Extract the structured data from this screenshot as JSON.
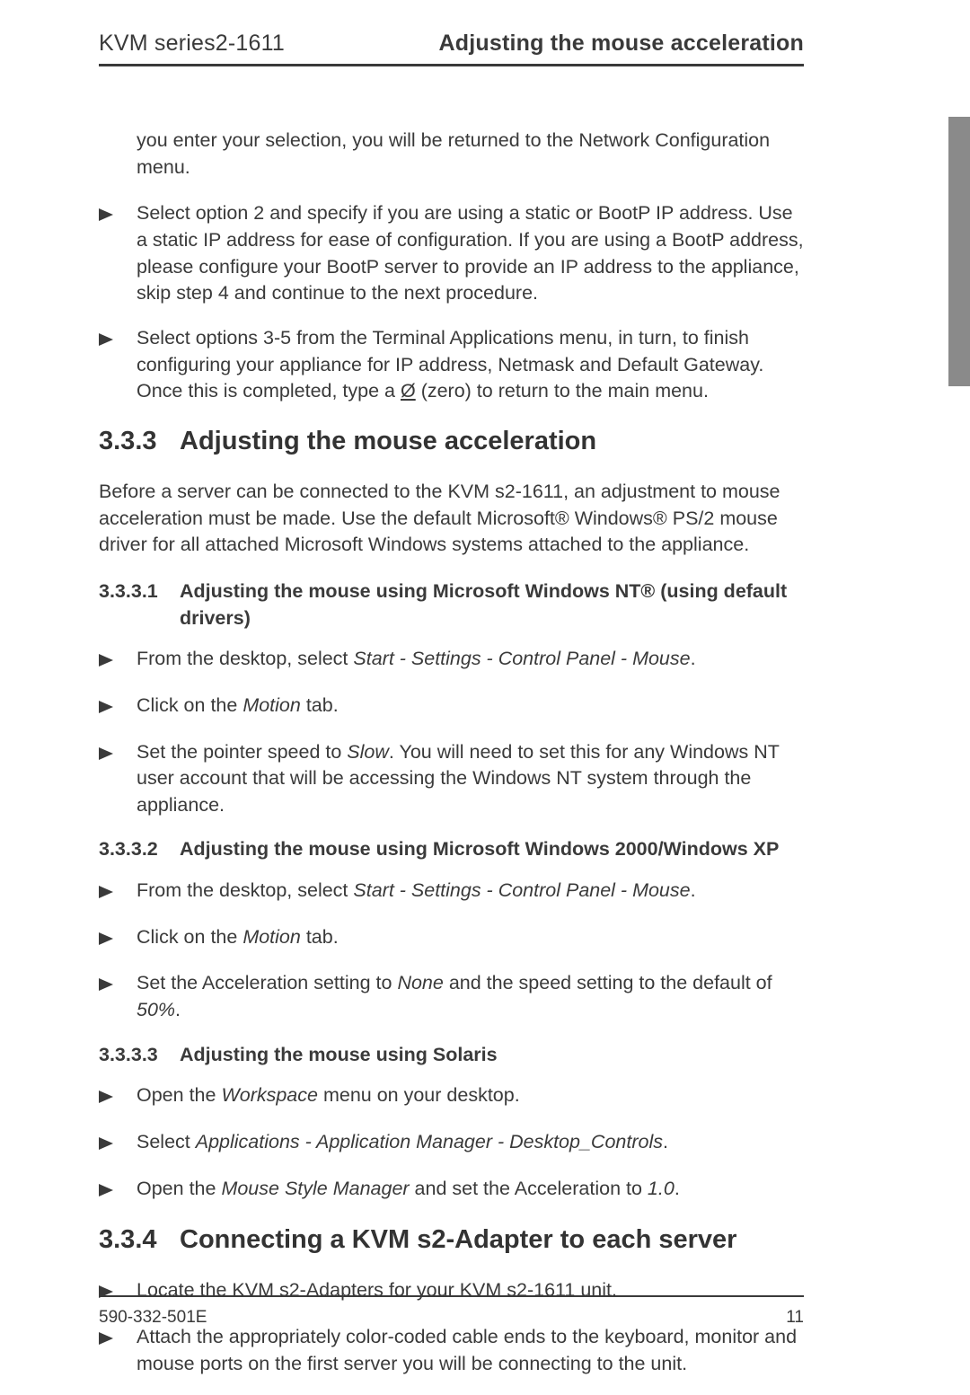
{
  "header": {
    "left": "KVM series2-1611",
    "right": "Adjusting the mouse acceleration"
  },
  "intro_continuation": "you enter your selection, you will be returned to the Network Configuration menu.",
  "top_bullets": [
    {
      "text": "Select option 2 and specify if you are using a static or BootP IP address. Use a static IP address for ease of configuration. If you are using a BootP address, please configure your BootP server to provide an IP address to the appliance, skip step 4 and continue to the next procedure."
    },
    {
      "pre": "Select options 3-5 from the Terminal Applications menu, in turn, to finish configuring your appliance for IP address, Netmask and Default Gateway. Once this is completed, type a ",
      "zero": "Ø",
      "post": "  (zero) to return to the main menu."
    }
  ],
  "sec_333": {
    "num": "3.3.3",
    "title": "Adjusting the mouse acceleration",
    "intro": "Before a server can be connected to the KVM s2-1611, an adjustment to mouse acceleration must be made. Use the default Microsoft® Windows® PS/2 mouse driver for all attached Microsoft Windows systems attached to the appliance."
  },
  "sec_3331": {
    "num": "3.3.3.1",
    "title": "Adjusting the mouse using Microsoft Windows NT® (using default drivers)",
    "bullets": [
      {
        "pre": "From the desktop, select ",
        "it": "Start - Settings - Control Panel - Mouse",
        "post": "."
      },
      {
        "pre": "Click on the ",
        "it": "Motion",
        "post": " tab."
      },
      {
        "pre": "Set the pointer speed to ",
        "it": "Slow",
        "post": ". You will need to set this for any Windows NT user account that will be accessing the Windows NT system through the appliance."
      }
    ]
  },
  "sec_3332": {
    "num": "3.3.3.2",
    "title": "Adjusting the mouse using Microsoft Windows 2000/Windows XP",
    "bullets": [
      {
        "pre": "From the desktop, select ",
        "it": "Start - Settings - Control Panel - Mouse",
        "post": "."
      },
      {
        "pre": "Click on the ",
        "it": "Motion",
        "post": " tab."
      },
      {
        "pre": "Set the Acceleration setting to ",
        "it": "None",
        "post1": " and the speed setting to the default of ",
        "it2": "50%",
        "post2": "."
      }
    ]
  },
  "sec_3333": {
    "num": "3.3.3.3",
    "title": "Adjusting the mouse using Solaris",
    "bullets": [
      {
        "pre": "Open the ",
        "it": "Workspace",
        "post": " menu on your desktop."
      },
      {
        "pre": "Select ",
        "it": "Applications - Application Manager - Desktop_Controls",
        "post": "."
      },
      {
        "pre": "Open the ",
        "it": "Mouse Style Manager",
        "post1": " and set the Acceleration to ",
        "it2": "1.0",
        "post2": "."
      }
    ]
  },
  "sec_334": {
    "num": "3.3.4",
    "title": "Connecting a KVM s2-Adapter to each server",
    "bullets": [
      {
        "text": "Locate the KVM s2-Adapters for your KVM s2-1611 unit."
      },
      {
        "text": "Attach the appropriately color-coded cable ends to the keyboard, monitor and mouse ports on the first server you will be connecting to the unit."
      }
    ]
  },
  "footer": {
    "left": "590-332-501E",
    "right": "11"
  }
}
